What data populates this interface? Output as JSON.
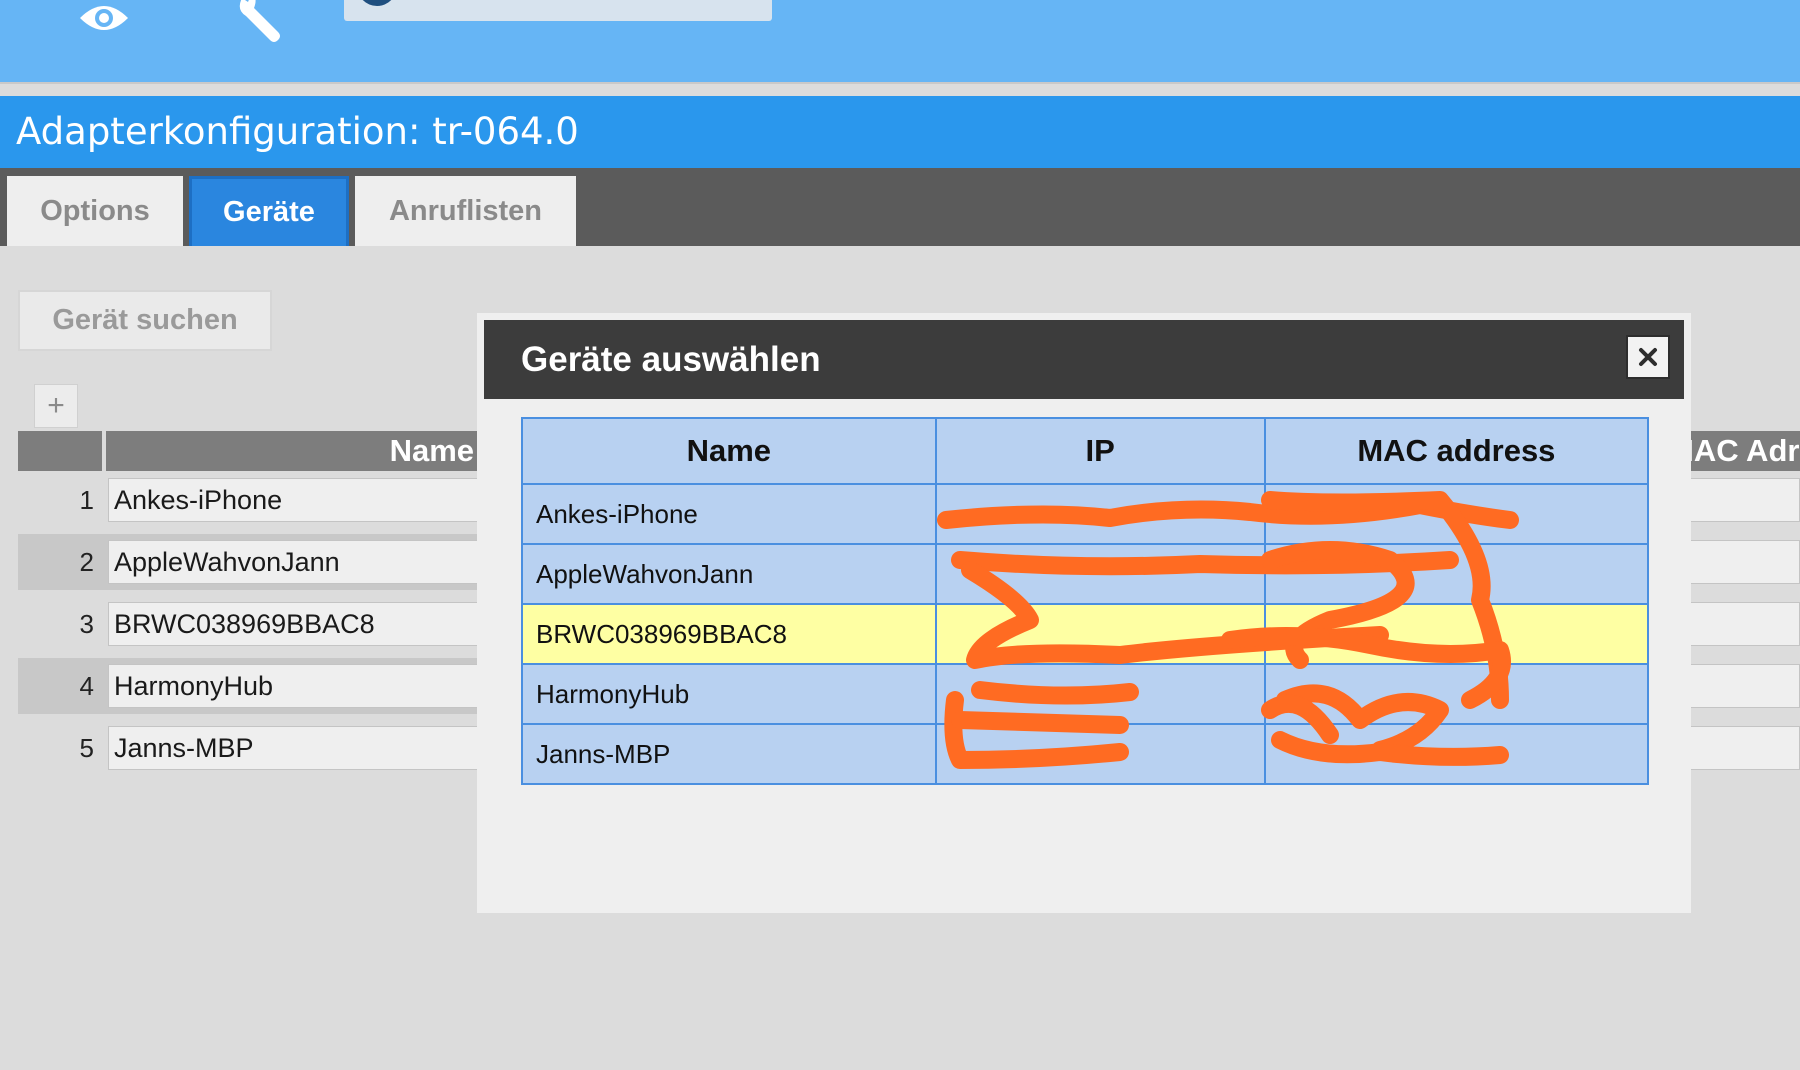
{
  "header": {
    "icons": [
      "eye-icon",
      "wrench-icon"
    ],
    "title": "Adapterkonfiguration: tr-064.0"
  },
  "tabs": [
    {
      "label": "Options",
      "active": false
    },
    {
      "label": "Geräte",
      "active": true
    },
    {
      "label": "Anruflisten",
      "active": false
    }
  ],
  "main": {
    "search_button": "Gerät suchen",
    "add_button": "+",
    "grid": {
      "name_header": "Name",
      "right_header": "MAC Adre",
      "rows": [
        {
          "index": "1",
          "name": "Ankes-iPhone"
        },
        {
          "index": "2",
          "name": "AppleWahvonJann"
        },
        {
          "index": "3",
          "name": "BRWC038969BBAC8"
        },
        {
          "index": "4",
          "name": "HarmonyHub"
        },
        {
          "index": "5",
          "name": "Janns-MBP"
        }
      ]
    }
  },
  "dialog": {
    "title": "Geräte auswählen",
    "columns": [
      "Name",
      "IP",
      "MAC address"
    ],
    "rows": [
      {
        "name": "Ankes-iPhone",
        "ip": "",
        "mac": "",
        "selected": false
      },
      {
        "name": "AppleWahvonJann",
        "ip": "",
        "mac": "",
        "selected": false
      },
      {
        "name": "BRWC038969BBAC8",
        "ip": "",
        "mac": "",
        "selected": true
      },
      {
        "name": "HarmonyHub",
        "ip": "",
        "mac": "",
        "selected": false
      },
      {
        "name": "Janns-MBP",
        "ip": "",
        "mac": "",
        "selected": false
      }
    ]
  },
  "colors": {
    "topbar": "#66b5f5",
    "titlebar": "#2a97ed",
    "active_tab": "#2a86df",
    "dialog_header": "#3c3c3c",
    "table_row": "#b8d1f1",
    "table_border": "#4a8fe0",
    "selected_row": "#feffa3",
    "redaction": "#ff6b22"
  }
}
